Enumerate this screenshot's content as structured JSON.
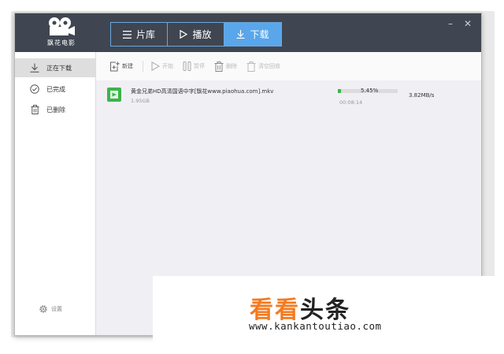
{
  "app": {
    "logo_text": "飘花电影"
  },
  "tabs": [
    {
      "label": "片库",
      "icon": "menu-icon"
    },
    {
      "label": "播放",
      "icon": "play-icon"
    },
    {
      "label": "下载",
      "icon": "download-icon",
      "active": true
    }
  ],
  "window_controls": {
    "minimize": "–",
    "close": "✕"
  },
  "sidebar": {
    "items": [
      {
        "label": "正在下载",
        "icon": "download-icon",
        "active": true
      },
      {
        "label": "已完成",
        "icon": "check-circle-icon"
      },
      {
        "label": "已删除",
        "icon": "trash-icon"
      }
    ],
    "settings_label": "设置"
  },
  "toolbar": {
    "new_label": "新建",
    "start_label": "开始",
    "pause_label": "暂停",
    "delete_label": "删除",
    "clear_label": "清空回收"
  },
  "downloads": [
    {
      "name": "黄金兄弟HD高清国语中字[飘花www.piaohua.com].mkv",
      "size": "1.95GB",
      "progress_text": "5.45%",
      "progress": 0.0545,
      "elapsed": "00:08:14",
      "speed": "3.82MB/s"
    }
  ],
  "watermark": {
    "brand_orange": "看看",
    "brand_dark": "头条",
    "url": "www.kankantoutiao.com"
  },
  "colors": {
    "titlebar": "#3f4651",
    "accent": "#5aa6ea",
    "progress": "#3bb54a",
    "brand": "#f47a1f"
  }
}
